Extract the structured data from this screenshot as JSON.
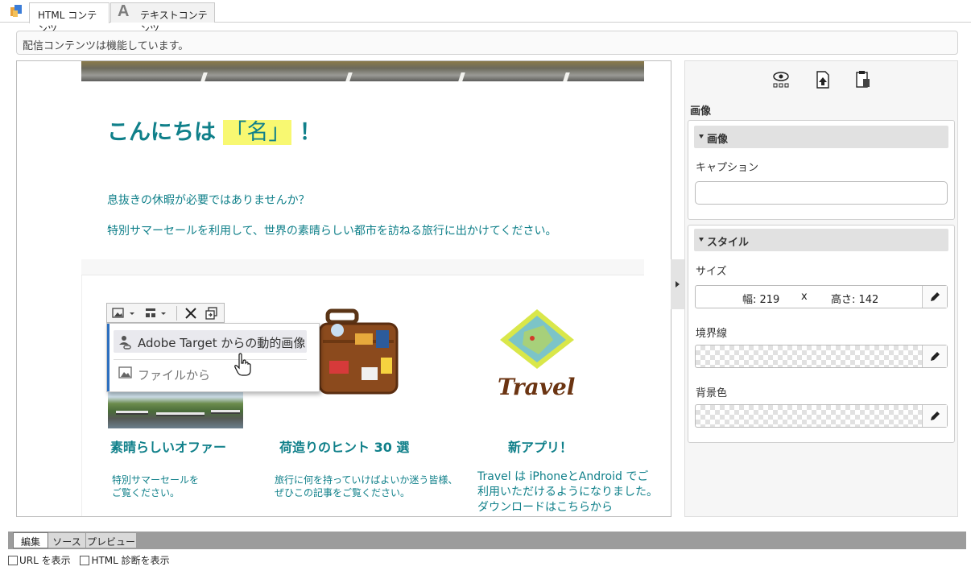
{
  "tabs": [
    {
      "label": "HTML コンテンツ",
      "active": true
    },
    {
      "label": "テキストコンテンツ",
      "icon": "text-A-icon",
      "icon_glyph": "A",
      "active": false
    }
  ],
  "status": "配信コンテンツは機能しています。",
  "content": {
    "greeting_prefix": "こんにちは",
    "greeting_name": "「名」",
    "greeting_suffix": "！",
    "para1": "息抜きの休暇が必要ではありませんか？",
    "para2": "特別サマーセールを利用して、世界の素晴らしい都市を訪ねる旅行に出かけてください。",
    "columns": [
      {
        "title": "素晴らしいオファー",
        "text": [
          "特別サマーセールを",
          "ご覧ください。"
        ]
      },
      {
        "title": "荷造りのヒント 30 選",
        "text": [
          "旅行に何を持っていけばよいか迷う皆様、",
          "ぜひこの記事をご覧ください。"
        ]
      },
      {
        "title": "新アプリ！",
        "text": [
          "Travel は iPhoneとAndroid でご",
          "利用いただけるようになりました。",
          "ダウンロードはこちらから"
        ]
      }
    ],
    "travel_logo_text": "Travel"
  },
  "image_menu": {
    "items": [
      "Adobe Target からの動的画像",
      "ファイルから"
    ]
  },
  "panel": {
    "section": "画像",
    "image_group": {
      "title": "画像",
      "caption_label": "キャプション",
      "caption_value": ""
    },
    "style_group": {
      "title": "スタイル",
      "size_label": "サイズ",
      "width_text": "幅: 219",
      "times": "x",
      "height_text": "高さ: 142",
      "border_label": "境界線",
      "bg_label": "背景色"
    }
  },
  "bottom_tabs": [
    "編集",
    "ソース",
    "プレビュー"
  ],
  "options": [
    "URL を表示",
    "HTML 診断を表示"
  ],
  "colors": {
    "text_teal": "#10808a",
    "highlight": "#f8f871",
    "accent_blue": "#2c6fbf"
  }
}
